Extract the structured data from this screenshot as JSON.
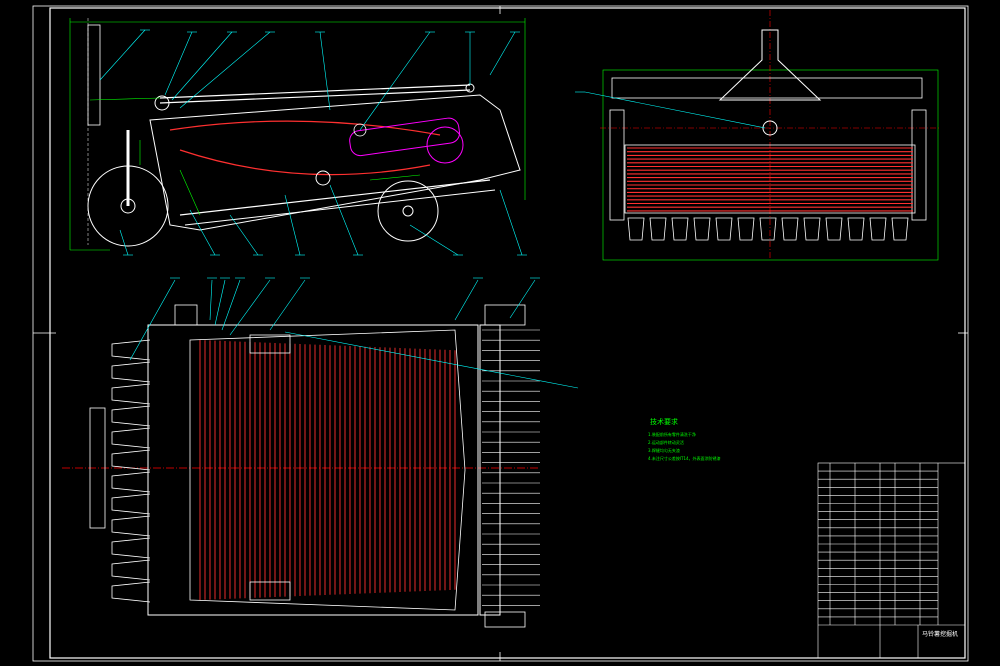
{
  "drawing": {
    "title": "马铃薯挖掘机",
    "tech_requirements_title": "技术要求",
    "tech_requirements": [
      "1.装配前所有零件清洗干净",
      "2.运动部件转动灵活",
      "3.焊缝均匀无夹渣",
      "4.未注尺寸公差按IT14，外表面涂防锈漆"
    ]
  },
  "colors": {
    "background": "#000000",
    "frame": "#ffffff",
    "centerline": "#ff0000",
    "dimension": "#00ff00",
    "leader": "#00ffff",
    "chain": "#ff3030",
    "part": "#ff00ff"
  }
}
